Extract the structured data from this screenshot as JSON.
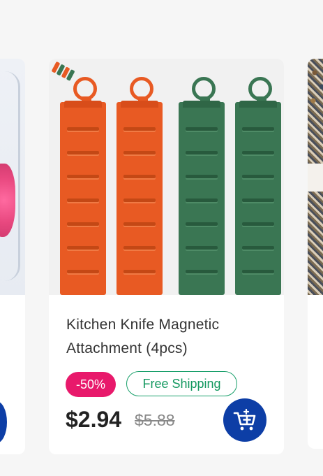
{
  "product": {
    "title": "Kitchen Knife Magnetic Attachment (4pcs)",
    "discount": "-50%",
    "shipping": "Free Shipping",
    "price": "$2.94",
    "original_price": "$5.88",
    "bar_colors": [
      "#e85a23",
      "#e85a23",
      "#3a7653",
      "#3a7653"
    ]
  },
  "colors": {
    "discount_badge": "#e8196b",
    "shipping_badge": "#1aa06b",
    "cart_button": "#0d3ea6",
    "background": "#f6f6f6"
  },
  "icons": {
    "cart": "add-to-cart-icon"
  }
}
